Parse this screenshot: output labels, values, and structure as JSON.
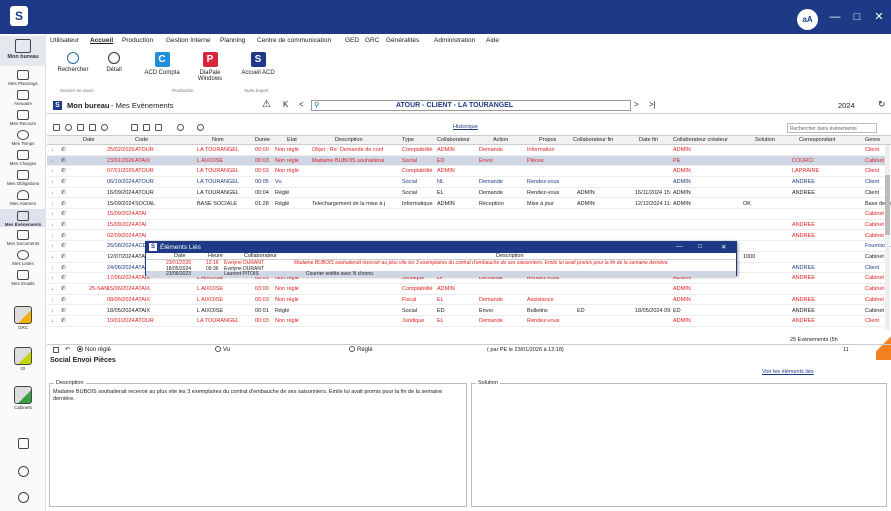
{
  "titlebar": {
    "avatar": "aA",
    "min": "—",
    "max": "□",
    "close": "✕",
    "logo": "S"
  },
  "sidebar": [
    {
      "label": "Mon bureau",
      "top": 0
    },
    {
      "label": "Mes Plannings"
    },
    {
      "label": "Annuaire"
    },
    {
      "label": "Mes Recours"
    },
    {
      "label": "Mes Temps"
    },
    {
      "label": "Mes Charges"
    },
    {
      "label": "Mes Obligations"
    },
    {
      "label": "Mes Alarmes"
    },
    {
      "label": "Mes Évènements"
    },
    {
      "label": "Mes Documents"
    },
    {
      "label": "Mes Listes"
    },
    {
      "label": "Mes Emails"
    },
    {
      "label": "GRC"
    },
    {
      "label": "GI"
    },
    {
      "label": "Cabinets"
    }
  ],
  "menu": [
    "Utilisateur",
    "Accueil",
    "Production",
    "Gestion Interne",
    "Planning",
    "Centre de communication",
    "GED",
    "GRC",
    "Généralités",
    "Administration",
    "Aide"
  ],
  "ribbon": {
    "rechercher": "Rechercher",
    "detail": "Détail",
    "acd_compta": "ACD Compta",
    "diapaie": "DiaPaie Windows",
    "accueil_acd": "Accueil ACD",
    "group_dossier": "Dossier en cours",
    "group_production": "Production",
    "group_suite": "Suite Expert"
  },
  "header": {
    "title": "Mon bureau",
    "subtitle": "- Mes Evènements",
    "warn": "⚠",
    "nav_first": "K",
    "nav_prev": "<",
    "client": "ATOUR  - CLIENT  - LA TOURANGEL",
    "nav_next": ">",
    "nav_last": ">|",
    "year": "2024"
  },
  "table": {
    "historique": "Historique",
    "search_placeholder": "Rechercher dans évènements",
    "columns": [
      "Date",
      "Code",
      "Nom",
      "Durée",
      "Etat",
      "Description",
      "Type",
      "Collaborateur",
      "Action",
      "Propos",
      "Collaborateur fin",
      "Date fin",
      "Collaborateur créateur",
      "Solution",
      "Correspondant",
      "Genre"
    ],
    "rows": [
      {
        "date": "25/02/2026",
        "code": "ATOUR",
        "nom": "LA TOURANGEL",
        "duree": "00:00",
        "etat": "Non réglé",
        "desc": "Objet : Re: Demande de conf",
        "type": "Comptabilité",
        "collab": "ADMIN",
        "action": "Demande",
        "propos": "Information",
        "cfin": "",
        "dfin": "",
        "creat": "ADMIN",
        "sol": "",
        "corr": "",
        "genre": "Client",
        "red": true
      },
      {
        "date": "23/01/2026",
        "code": "ATAIX",
        "nom": "L AIXOISE",
        "duree": "00:03",
        "etat": "Non réglé",
        "desc": "Madame BUBOIS souhaiterai",
        "type": "Social",
        "collab": "ED",
        "action": "Envoi",
        "propos": "Pièces",
        "cfin": "",
        "dfin": "",
        "creat": "PE",
        "sol": "",
        "corr": "COURCI",
        "genre": "Cabinet",
        "red": true,
        "sel": true
      },
      {
        "date": "07/01/2026",
        "code": "ATOUR",
        "nom": "LA TOURANGEL",
        "duree": "00:03",
        "etat": "Non réglé",
        "desc": "",
        "type": "Comptabilité",
        "collab": "ADMIN",
        "action": "",
        "propos": "",
        "cfin": "",
        "dfin": "",
        "creat": "ADMIN",
        "sol": "",
        "corr": "LAPRAIRE",
        "genre": "Client",
        "red": true
      },
      {
        "date": "06/10/2024",
        "code": "ATOUR",
        "nom": "LA TOURANGEL",
        "duree": "00:05",
        "etat": "Vu",
        "desc": "",
        "type": "Social",
        "collab": "NL",
        "action": "Demande",
        "propos": "Rendez-vous",
        "cfin": "",
        "dfin": "",
        "creat": "ADMIN",
        "sol": "",
        "corr": "ANDREE",
        "genre": "Client",
        "blue": true
      },
      {
        "date": "16/09/2024",
        "code": "ATOUR",
        "nom": "LA TOURANGEL",
        "duree": "00:04",
        "etat": "Réglé",
        "desc": "",
        "type": "Social",
        "collab": "EL",
        "action": "Demande",
        "propos": "Rendez-vous",
        "cfin": "ADMIN",
        "dfin": "16/11/2024 15:",
        "creat": "ADMIN",
        "sol": "",
        "corr": "ANDREE",
        "genre": "Client"
      },
      {
        "date": "15/09/2024",
        "code": "SOCIAL",
        "nom": "BASE SOCIALE",
        "duree": "01:28",
        "etat": "Réglé",
        "desc": "Telechargement de la mise à j",
        "type": "Informatique",
        "collab": "ADMIN",
        "action": "Réception",
        "propos": "Mise à jour",
        "cfin": "ADMIN",
        "dfin": "12/12/2024 11:",
        "creat": "ADMIN",
        "sol": "OK",
        "corr": "",
        "genre": "Base de co"
      },
      {
        "date": "15/09/2024",
        "code": "ATAI",
        "nom": "",
        "duree": "",
        "etat": "",
        "desc": "",
        "type": "",
        "collab": "",
        "action": "",
        "propos": "",
        "cfin": "",
        "dfin": "",
        "creat": "",
        "sol": "",
        "corr": "",
        "genre": "Cabinet",
        "red": true
      },
      {
        "date": "15/09/2024",
        "code": "ATAI",
        "nom": "",
        "duree": "",
        "etat": "",
        "desc": "",
        "type": "",
        "collab": "",
        "action": "",
        "propos": "",
        "cfin": "",
        "dfin": "",
        "creat": "",
        "sol": "",
        "corr": "ANDREE",
        "genre": "Cabinet",
        "red": true
      },
      {
        "date": "02/09/2024",
        "code": "ATAI",
        "nom": "",
        "duree": "",
        "etat": "",
        "desc": "",
        "type": "",
        "collab": "",
        "action": "",
        "propos": "",
        "cfin": "",
        "dfin": "",
        "creat": "",
        "sol": "",
        "corr": "ANDREE",
        "genre": "Cabinet",
        "red": true
      },
      {
        "date": "26/08/2024",
        "code": "ACD",
        "nom": "",
        "duree": "",
        "etat": "",
        "desc": "",
        "type": "",
        "collab": "",
        "action": "",
        "propos": "",
        "cfin": "",
        "dfin": "",
        "creat": "",
        "sol": "",
        "corr": "",
        "genre": "Fournisseu",
        "blue": true
      },
      {
        "date": "12/07/2024",
        "code": "ATAI",
        "nom": "",
        "duree": "",
        "etat": "",
        "desc": "",
        "type": "",
        "collab": "",
        "action": "",
        "propos": "",
        "cfin": "",
        "dfin": "",
        "creat": "",
        "sol": "1000",
        "corr": "",
        "genre": "Cabinet"
      },
      {
        "date": "24/06/2024",
        "code": "ATAIX",
        "nom": "LA TOURANGEL",
        "duree": "00:04",
        "etat": "Vu",
        "desc": "",
        "type": "Social",
        "collab": "EL",
        "action": "Demande",
        "propos": "Rendez-vous",
        "cfin": "",
        "dfin": "",
        "creat": "ADMIN",
        "sol": "",
        "corr": "ANDREE",
        "genre": "Client",
        "blue": true
      },
      {
        "date": "17/06/2024",
        "code": "ATAIX",
        "nom": "L AIXOISE",
        "duree": "00:01",
        "etat": "Non réglé",
        "desc": "",
        "type": "Juridique",
        "collab": "LP",
        "action": "Demande",
        "propos": "Rendez-vous",
        "cfin": "",
        "dfin": "",
        "creat": "ADMIN",
        "sol": "",
        "corr": "ANDREE",
        "genre": "Cabinet",
        "red": true
      },
      {
        "date": "15/06/2024",
        "code": "ATAIX",
        "nom": "L AIXOISE",
        "duree": "03:00",
        "etat": "Non réglé",
        "desc": "",
        "type": "Comptabilité",
        "collab": "ADMIN",
        "action": "",
        "propos": "",
        "cfin": "",
        "dfin": "",
        "creat": "ADMIN",
        "sol": "",
        "corr": "",
        "genre": "Cabinet",
        "red": true,
        "pre": "25-SAN"
      },
      {
        "date": "08/06/2024",
        "code": "ATAIX",
        "nom": "L AIXOISE",
        "duree": "00:03",
        "etat": "Non réglé",
        "desc": "",
        "type": "Fiscal",
        "collab": "EL",
        "action": "Demande",
        "propos": "Assistance",
        "cfin": "",
        "dfin": "",
        "creat": "ADMIN",
        "sol": "",
        "corr": "ANDREE",
        "genre": "Cabinet",
        "red": true
      },
      {
        "date": "18/05/2024",
        "code": "ATAIX",
        "nom": "L AIXOISE",
        "duree": "00:01",
        "etat": "Réglé",
        "desc": "",
        "type": "Social",
        "collab": "ED",
        "action": "Envoi",
        "propos": "Bulletins",
        "cfin": "ED",
        "dfin": "18/05/2024 09:",
        "creat": "ED",
        "sol": "",
        "corr": "ANDREE",
        "genre": "Cabinet"
      },
      {
        "date": "10/01/2024",
        "code": "ATOUR",
        "nom": "LA TOURANGEL",
        "duree": "00:03",
        "etat": "Non réglé",
        "desc": "",
        "type": "Juridique",
        "collab": "EL",
        "action": "Demande",
        "propos": "Rendez-vous",
        "cfin": "",
        "dfin": "",
        "creat": "ADMIN",
        "sol": "",
        "corr": "ANDREE",
        "genre": "Client",
        "red": true
      }
    ],
    "count": "25 Evènements (5h",
    "right_top": "Rechercher dans évènements"
  },
  "popup": {
    "title": "Éléments Liés",
    "columns": [
      "Date",
      "Heure",
      "Collaborateur",
      "Description"
    ],
    "rows": [
      {
        "date": "23/01/2026",
        "heure": "12:18",
        "collab": "Evelyne DURANT",
        "desc": "Madame BUBOIS souhaiterait recevoir au plus vite les 3 exemplaires du contrat d'embauche de ses saisonniers. Emile lui avait promis pour la fin de la semaine dernière.",
        "red": true
      },
      {
        "date": "18/05/2024",
        "heure": "09:36",
        "collab": "Evelyne DURANT",
        "desc": ""
      },
      {
        "date": "23/06/2023",
        "heure": "",
        "collab": "Laurent PITOIS",
        "desc": "Courrier entête avec N chrono",
        "sel": true
      }
    ]
  },
  "footer": {
    "non_regle": "Non réglé",
    "vu": "Vu",
    "regle": "Réglé",
    "par": "( par PE le 23/01/2026 à 12:18)",
    "count": "11",
    "link": "Voir les éléments liés"
  },
  "detail": {
    "title": "Social Envoi Pièces",
    "desc_label": "Description",
    "desc_text": "Madame BUBOIS souhaiterait recevoir au plus vite les 3 exemplaires du contrat d'embauche de ses saisonniers. Emile lui avait promis pour la fin de la semaine dernière.",
    "sol_label": "Solution"
  }
}
